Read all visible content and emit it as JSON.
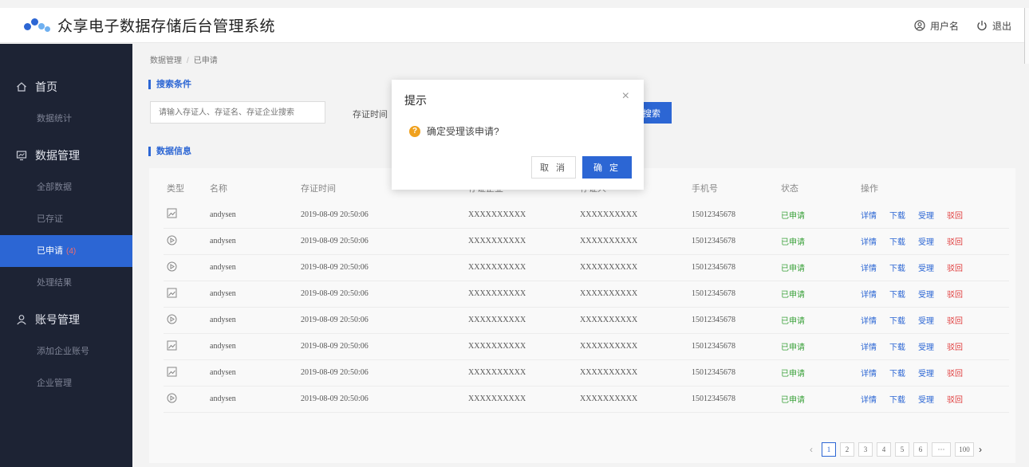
{
  "header": {
    "title": "众享电子数据存储后台管理系统",
    "user_label": "用户名",
    "logout_label": "退出"
  },
  "sidebar": {
    "groups": [
      {
        "label": "首页",
        "items": [
          "数据统计"
        ]
      },
      {
        "label": "数据管理",
        "items": [
          "全部数据",
          "已存证",
          "已申请",
          "处理结果"
        ]
      },
      {
        "label": "账号管理",
        "items": [
          "添加企业账号",
          "企业管理"
        ]
      }
    ],
    "active_count": "(4)"
  },
  "breadcrumb": {
    "parent": "数据管理",
    "sep": "/",
    "current": "已申请"
  },
  "search": {
    "section_title": "搜索条件",
    "placeholder": "请输入存证人、存证名、存证企业搜索",
    "time_label": "存证时间",
    "button_label": "搜索"
  },
  "table": {
    "section_title": "数据信息",
    "columns": [
      "类型",
      "名称",
      "存证时间",
      "存证企业",
      "存证人",
      "手机号",
      "状态",
      "操作"
    ],
    "rows": [
      {
        "type": "image",
        "name": "andysen",
        "time": "2019-08-09 20:50:06",
        "enterprise": "XXXXXXXXXX",
        "person": "XXXXXXXXXX",
        "phone": "15012345678",
        "status": "已申请"
      },
      {
        "type": "video",
        "name": "andysen",
        "time": "2019-08-09 20:50:06",
        "enterprise": "XXXXXXXXXX",
        "person": "XXXXXXXXXX",
        "phone": "15012345678",
        "status": "已申请"
      },
      {
        "type": "video",
        "name": "andysen",
        "time": "2019-08-09 20:50:06",
        "enterprise": "XXXXXXXXXX",
        "person": "XXXXXXXXXX",
        "phone": "15012345678",
        "status": "已申请"
      },
      {
        "type": "image",
        "name": "andysen",
        "time": "2019-08-09 20:50:06",
        "enterprise": "XXXXXXXXXX",
        "person": "XXXXXXXXXX",
        "phone": "15012345678",
        "status": "已申请"
      },
      {
        "type": "video",
        "name": "andysen",
        "time": "2019-08-09 20:50:06",
        "enterprise": "XXXXXXXXXX",
        "person": "XXXXXXXXXX",
        "phone": "15012345678",
        "status": "已申请"
      },
      {
        "type": "image",
        "name": "andysen",
        "time": "2019-08-09 20:50:06",
        "enterprise": "XXXXXXXXXX",
        "person": "XXXXXXXXXX",
        "phone": "15012345678",
        "status": "已申请"
      },
      {
        "type": "image",
        "name": "andysen",
        "time": "2019-08-09 20:50:06",
        "enterprise": "XXXXXXXXXX",
        "person": "XXXXXXXXXX",
        "phone": "15012345678",
        "status": "已申请"
      },
      {
        "type": "video",
        "name": "andysen",
        "time": "2019-08-09 20:50:06",
        "enterprise": "XXXXXXXXXX",
        "person": "XXXXXXXXXX",
        "phone": "15012345678",
        "status": "已申请"
      }
    ],
    "actions": {
      "detail": "详情",
      "download": "下载",
      "accept": "受理",
      "reject": "驳回"
    }
  },
  "pagination": {
    "pages": [
      "1",
      "2",
      "3",
      "4",
      "5",
      "6",
      "···",
      "100"
    ],
    "current": "1",
    "prev": "‹",
    "next": "›"
  },
  "dialog": {
    "title": "提示",
    "close": "×",
    "message": "确定受理该申请?",
    "icon": "?",
    "cancel_label": "取 消",
    "ok_label": "确 定"
  },
  "colors": {
    "primary": "#2c66d4",
    "sidebar": "#1d2334",
    "success": "#3aa13a",
    "danger": "#e03b3b",
    "warning": "#f0a11e"
  }
}
